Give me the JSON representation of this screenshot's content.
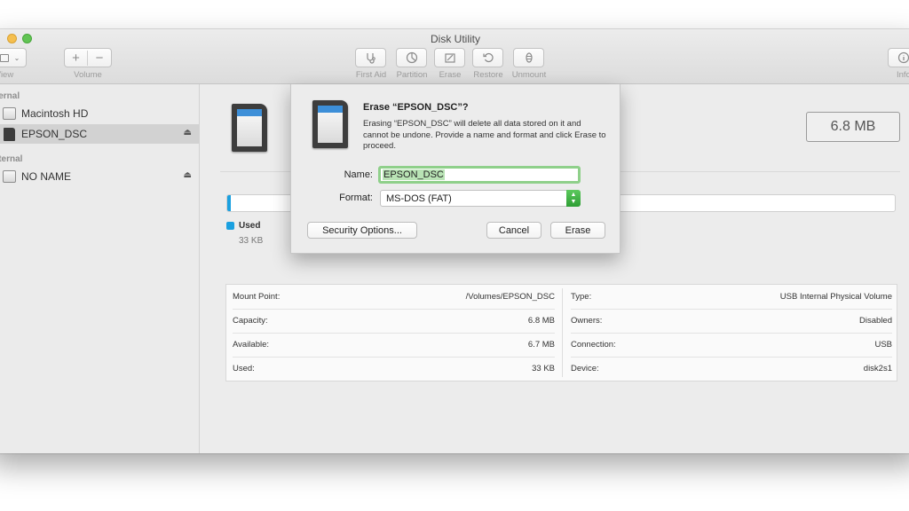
{
  "window": {
    "title": "Disk Utility"
  },
  "toolbar": {
    "view_label": "View",
    "volume_label": "Volume",
    "add_symbol": "+",
    "remove_symbol": "−",
    "first_aid_label": "First Aid",
    "partition_label": "Partition",
    "erase_label": "Erase",
    "restore_label": "Restore",
    "unmount_label": "Unmount",
    "info_label": "Info"
  },
  "sidebar": {
    "internal_header": "Internal",
    "external_header": "External",
    "items": [
      {
        "label": "Macintosh HD",
        "icon": "hard-disk-icon"
      },
      {
        "label": "EPSON_DSC",
        "icon": "sd-card-icon",
        "selected": true
      },
      {
        "label": "NO NAME",
        "icon": "disk-icon"
      }
    ]
  },
  "main": {
    "size_value": "6.8 MB",
    "usage": {
      "used_fraction": 0.005,
      "color": "#1aa0e0"
    },
    "legend": {
      "name": "Used",
      "value": "33 KB"
    },
    "info_left": [
      {
        "key": "Mount Point:",
        "value": "/Volumes/EPSON_DSC"
      },
      {
        "key": "Capacity:",
        "value": "6.8 MB"
      },
      {
        "key": "Available:",
        "value": "6.7 MB"
      },
      {
        "key": "Used:",
        "value": "33 KB"
      }
    ],
    "info_right": [
      {
        "key": "Type:",
        "value": "USB Internal Physical Volume"
      },
      {
        "key": "Owners:",
        "value": "Disabled"
      },
      {
        "key": "Connection:",
        "value": "USB"
      },
      {
        "key": "Device:",
        "value": "disk2s1"
      }
    ]
  },
  "dialog": {
    "title": "Erase “EPSON_DSC”?",
    "message": "Erasing “EPSON_DSC” will delete all data stored on it and cannot be undone. Provide a name and format and click Erase to proceed.",
    "name_label": "Name:",
    "name_value": "EPSON_DSC",
    "format_label": "Format:",
    "format_value": "MS-DOS (FAT)",
    "security_button": "Security Options...",
    "cancel_button": "Cancel",
    "erase_button": "Erase"
  },
  "colors": {
    "accent_green": "#61c454",
    "focus_ring": "#8fd08a",
    "usage_blue": "#1aa0e0"
  }
}
